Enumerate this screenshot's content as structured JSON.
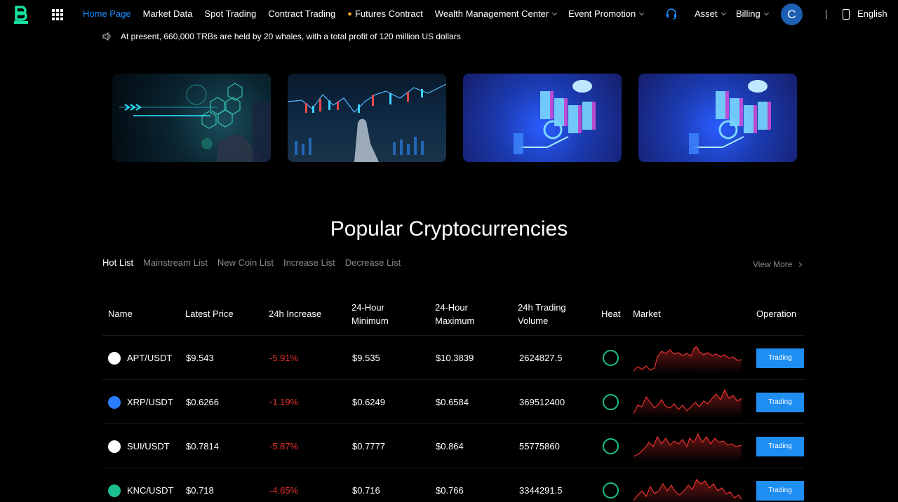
{
  "nav": {
    "items": [
      {
        "label": "Home Page",
        "active": true,
        "dropdown": false,
        "icon": ""
      },
      {
        "label": "Market Data",
        "active": false,
        "dropdown": false,
        "icon": ""
      },
      {
        "label": "Spot Trading",
        "active": false,
        "dropdown": false,
        "icon": ""
      },
      {
        "label": "Contract Trading",
        "active": false,
        "dropdown": false,
        "icon": ""
      },
      {
        "label": "Futures Contract",
        "active": false,
        "dropdown": false,
        "icon": "fire-icon"
      },
      {
        "label": "Wealth Management Center",
        "active": false,
        "dropdown": true,
        "icon": ""
      },
      {
        "label": "Event Promotion",
        "active": false,
        "dropdown": true,
        "icon": ""
      }
    ],
    "asset_label": "Asset",
    "billing_label": "Billing",
    "avatar_letter": "C",
    "language_label": "English"
  },
  "notice": {
    "text": "At present, 660,000 TRBs are held by 20 whales, with a total profit of 120 million US dollars"
  },
  "heading": "Popular Cryptocurrencies",
  "tabs": [
    "Hot List",
    "Mainstream List",
    "New Coin List",
    "Increase List",
    "Decrease List"
  ],
  "view_more": "View More",
  "table": {
    "headers": {
      "name": "Name",
      "price": "Latest Price",
      "increase": "24h Increase",
      "min": "24-Hour Minimum",
      "max": "24-Hour Maximum",
      "volume": "24h Trading Volume",
      "heat": "Heat",
      "market": "Market",
      "operation": "Operation"
    },
    "rows": [
      {
        "pair": "APT/USDT",
        "price": "$9.543",
        "increase": "-5.91%",
        "min": "$9.535",
        "max": "$10.3839",
        "volume": "2624827.5",
        "button": "Trading",
        "icon_color": "#ffffff",
        "icon": "apt-icon"
      },
      {
        "pair": "XRP/USDT",
        "price": "$0.6266",
        "increase": "-1.19%",
        "min": "$0.6249",
        "max": "$0.6584",
        "volume": "369512400",
        "button": "Trading",
        "icon_color": "#2b7cff",
        "icon": "xrp-icon"
      },
      {
        "pair": "SUI/USDT",
        "price": "$0.7814",
        "increase": "-5.87%",
        "min": "$0.7777",
        "max": "$0.864",
        "volume": "55775860",
        "button": "Trading",
        "icon_color": "#ffffff",
        "icon": "sui-icon"
      },
      {
        "pair": "KNC/USDT",
        "price": "$0.718",
        "increase": "-4.65%",
        "min": "$0.716",
        "max": "$0.766",
        "volume": "3344291.5",
        "button": "Trading",
        "icon_color": "#1dbf8f",
        "icon": "knc-icon"
      }
    ]
  },
  "colors": {
    "accent": "#1a8cff",
    "negative": "#e8312f",
    "heat": "#18c08b",
    "button": "#1e8ef2",
    "spark": "#e8312f"
  }
}
